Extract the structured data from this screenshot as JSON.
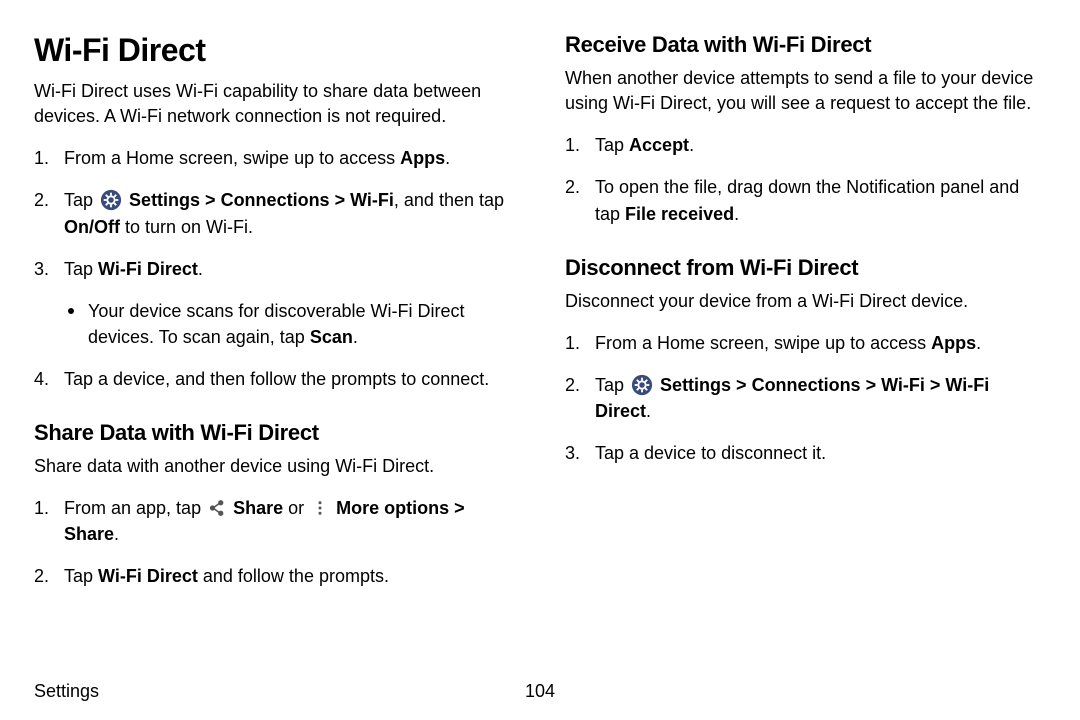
{
  "footer": {
    "section": "Settings",
    "page": "104"
  },
  "title": "Wi-Fi Direct",
  "intro": "Wi-Fi Direct uses Wi-Fi capability to share data between devices. A Wi-Fi network connection is not required.",
  "steps_main": {
    "s1_a": "From a Home screen, swipe up to access ",
    "s1_b": "Apps",
    "s1_c": ".",
    "s2_a": "Tap ",
    "s2_b": "Settings > Connections > Wi-Fi",
    "s2_c": ", and then tap ",
    "s2_d": "On/Off",
    "s2_e": " to turn on Wi-Fi.",
    "s3_a": "Tap ",
    "s3_b": "Wi-Fi Direct",
    "s3_c": ".",
    "s3_bullet_a": "Your device scans for discoverable Wi-Fi Direct devices. To scan again, tap ",
    "s3_bullet_b": "Scan",
    "s3_bullet_c": ".",
    "s4": "Tap a device, and then follow the prompts to connect."
  },
  "share": {
    "heading": "Share Data with Wi-Fi Direct",
    "intro": "Share data with another device using Wi-Fi Direct.",
    "s1_a": "From an app, tap ",
    "s1_b": "Share",
    "s1_c": " or ",
    "s1_d": "More options > Share",
    "s1_e": ".",
    "s2_a": "Tap ",
    "s2_b": "Wi-Fi Direct",
    "s2_c": " and follow the prompts."
  },
  "receive": {
    "heading": "Receive Data with Wi-Fi Direct",
    "intro": "When another device attempts to send a file to your device using Wi-Fi Direct, you will see a request to accept the file.",
    "s1_a": "Tap ",
    "s1_b": "Accept",
    "s1_c": ".",
    "s2_a": "To open the file, drag down the Notification panel and tap ",
    "s2_b": "File received",
    "s2_c": "."
  },
  "disconnect": {
    "heading": "Disconnect from Wi-Fi Direct",
    "intro": "Disconnect your device from a Wi-Fi Direct device.",
    "s1_a": "From a Home screen, swipe up to access ",
    "s1_b": "Apps",
    "s1_c": ".",
    "s2_a": "Tap ",
    "s2_b": "Settings > Connections > Wi-Fi > Wi-Fi Direct",
    "s2_c": ".",
    "s3": "Tap a device to disconnect it."
  }
}
